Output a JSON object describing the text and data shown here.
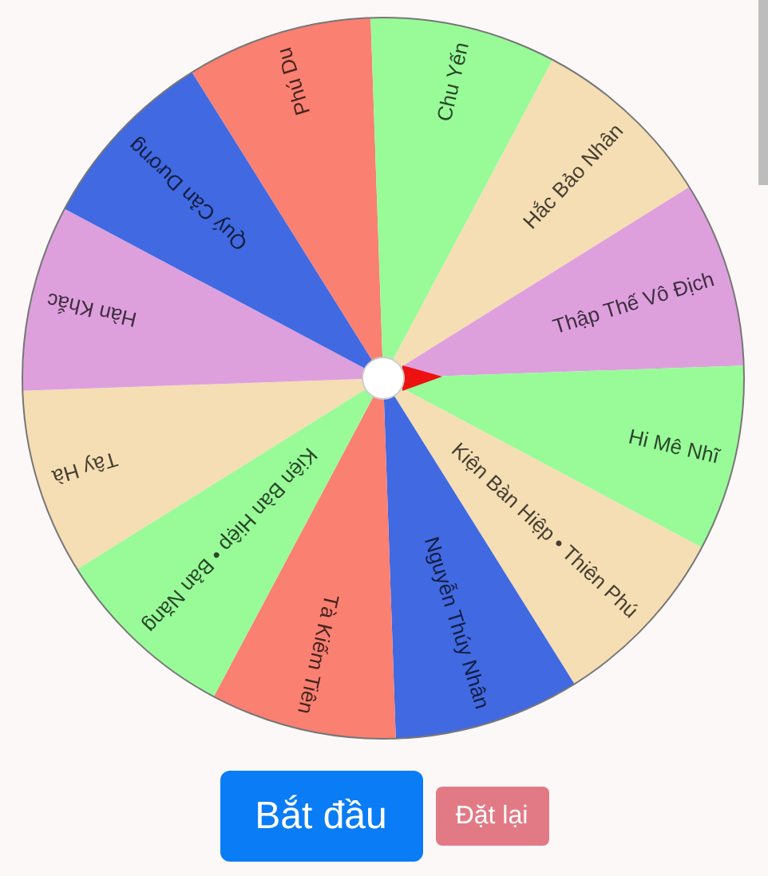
{
  "wheel": {
    "segments": [
      {
        "label": "Phú Du",
        "color": "#fa8072"
      },
      {
        "label": "Chu Yến",
        "color": "#98fb98"
      },
      {
        "label": "Hắc Bảo Nhân",
        "color": "#f5deb3"
      },
      {
        "label": "Thập Thế Vô Địch",
        "color": "#dda0dd"
      },
      {
        "label": "Hi Mê Nhĩ",
        "color": "#98fb98"
      },
      {
        "label": "Kiện Bàn Hiệp • Thiên Phú",
        "color": "#f5deb3"
      },
      {
        "label": "Nguyễn Thúy Nhân",
        "color": "#4169e1"
      },
      {
        "label": "Tà Kiếm Tiên",
        "color": "#fa8072"
      },
      {
        "label": "Kiện Bàn Hiệp • Bản Năng",
        "color": "#98fb98"
      },
      {
        "label": "Tây Hà",
        "color": "#f5deb3"
      },
      {
        "label": "Hàn Khắc",
        "color": "#dda0dd"
      },
      {
        "label": "Quý Cản Dương",
        "color": "#4169e1"
      }
    ]
  },
  "buttons": [
    {
      "label": "Bắt đầu",
      "kind": "primary"
    },
    {
      "label": "Đặt lại",
      "kind": "secondary"
    }
  ]
}
